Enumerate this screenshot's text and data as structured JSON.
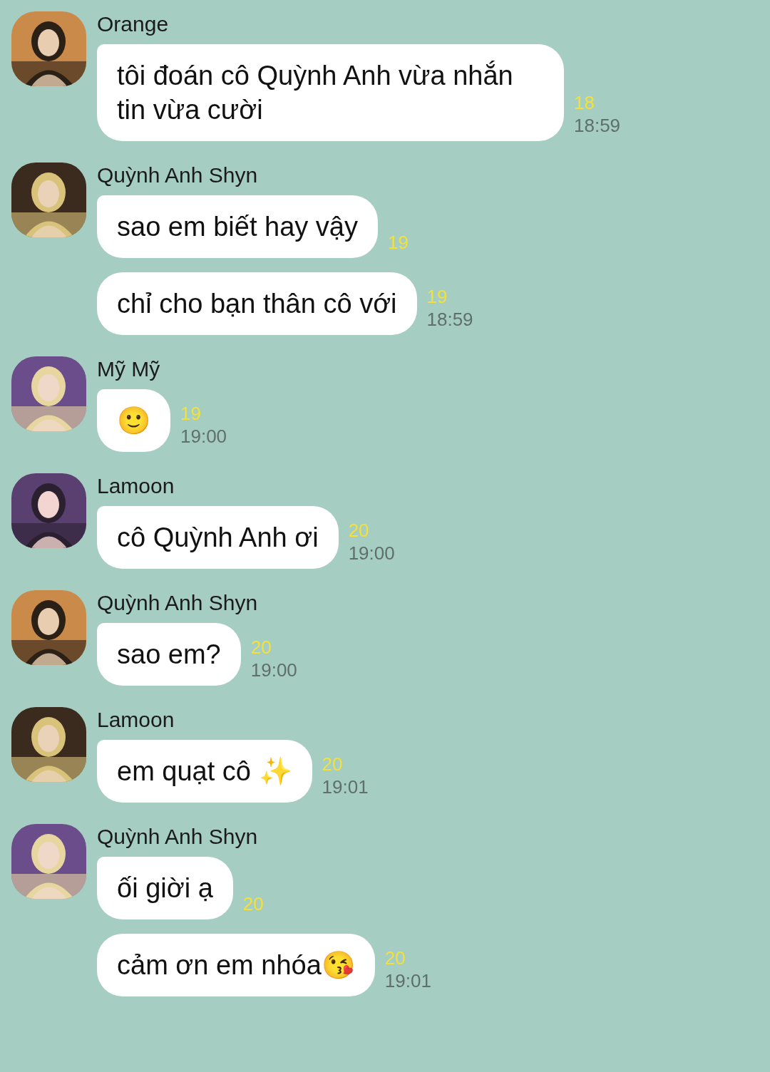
{
  "groups": [
    {
      "sender": "Orange",
      "avatar": {
        "kind": "picture"
      },
      "messages": [
        {
          "text": "tôi đoán cô Quỳnh Anh vừa nhắn tin vừa cười",
          "read_count": "18",
          "time": "18:59"
        }
      ]
    },
    {
      "sender": "Quỳnh Anh Shyn",
      "avatar": {
        "kind": "picture"
      },
      "messages": [
        {
          "text": "sao em biết hay vậy",
          "read_count": "19"
        },
        {
          "text": "chỉ cho bạn thân cô với",
          "read_count": "19",
          "time": "18:59"
        }
      ]
    },
    {
      "sender": "Mỹ Mỹ",
      "avatar": {
        "kind": "picture"
      },
      "messages": [
        {
          "text": "🙂",
          "read_count": "19",
          "time": "19:00"
        }
      ]
    },
    {
      "sender": "Lamoon",
      "avatar": {
        "kind": "picture"
      },
      "messages": [
        {
          "text": "cô Quỳnh Anh ơi",
          "read_count": "20",
          "time": "19:00"
        }
      ]
    },
    {
      "sender": "Quỳnh Anh Shyn",
      "avatar": {
        "kind": "picture"
      },
      "messages": [
        {
          "text": "sao em?",
          "read_count": "20",
          "time": "19:00"
        }
      ]
    },
    {
      "sender": "Lamoon",
      "avatar": {
        "kind": "picture"
      },
      "messages": [
        {
          "text": "em quạt cô ✨",
          "read_count": "20",
          "time": "19:01"
        }
      ]
    },
    {
      "sender": "Quỳnh Anh Shyn",
      "avatar": {
        "kind": "picture"
      },
      "messages": [
        {
          "text": "ối giời ạ",
          "read_count": "20"
        },
        {
          "text": "cảm ơn em nhóa😘",
          "read_count": "20",
          "time": "19:01"
        }
      ]
    }
  ]
}
